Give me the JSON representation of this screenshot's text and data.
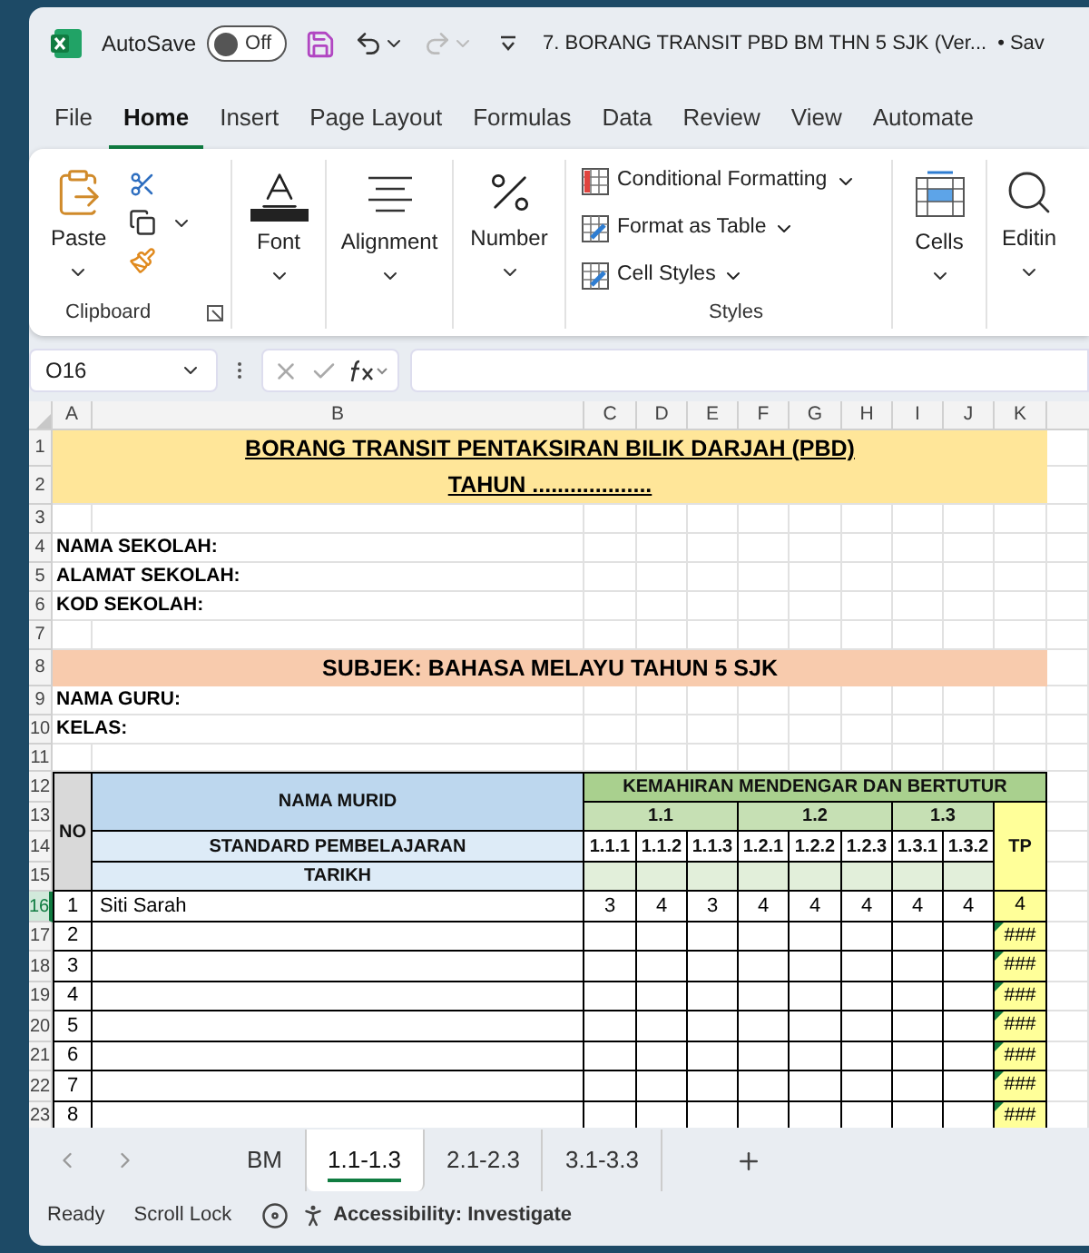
{
  "title_bar": {
    "autosave_label": "AutoSave",
    "autosave_toggle": {
      "label": "Off",
      "on": false
    },
    "redo_disabled": true,
    "document_title": "7. BORANG TRANSIT PBD BM THN 5 SJK (Ver...",
    "save_status": "• Sav"
  },
  "menu_tabs": [
    {
      "label": "File",
      "selected": false
    },
    {
      "label": "Home",
      "selected": true
    },
    {
      "label": "Insert",
      "selected": false
    },
    {
      "label": "Page Layout",
      "selected": false
    },
    {
      "label": "Formulas",
      "selected": false
    },
    {
      "label": "Data",
      "selected": false
    },
    {
      "label": "Review",
      "selected": false
    },
    {
      "label": "View",
      "selected": false
    },
    {
      "label": "Automate",
      "selected": false
    }
  ],
  "ribbon": {
    "paste": "Paste",
    "clipboard_group": "Clipboard",
    "font": "Font",
    "alignment": "Alignment",
    "number": "Number",
    "styles_items": [
      "Conditional Formatting",
      "Format as Table",
      "Cell Styles"
    ],
    "styles_group": "Styles",
    "cells": "Cells",
    "editing": "Editin"
  },
  "formula_bar": {
    "name_box": "O16"
  },
  "sheet": {
    "columns": [
      "A",
      "B",
      "C",
      "D",
      "E",
      "F",
      "G",
      "H",
      "I",
      "J",
      "K"
    ],
    "rows": [
      {
        "label": "1",
        "selected": false
      },
      {
        "label": "2",
        "selected": false
      },
      {
        "label": "3",
        "selected": false
      },
      {
        "label": "4",
        "selected": false
      },
      {
        "label": "5",
        "selected": false
      },
      {
        "label": "6",
        "selected": false
      },
      {
        "label": "7",
        "selected": false
      },
      {
        "label": "8",
        "selected": false
      },
      {
        "label": "9",
        "selected": false
      },
      {
        "label": "10",
        "selected": false
      },
      {
        "label": "11",
        "selected": false
      },
      {
        "label": "12",
        "selected": false
      },
      {
        "label": "13",
        "selected": false
      },
      {
        "label": "14",
        "selected": false
      },
      {
        "label": "15",
        "selected": false
      },
      {
        "label": "16",
        "selected": true
      },
      {
        "label": "17",
        "selected": false
      },
      {
        "label": "18",
        "selected": false
      },
      {
        "label": "19",
        "selected": false
      },
      {
        "label": "20",
        "selected": false
      },
      {
        "label": "21",
        "selected": false
      },
      {
        "label": "22",
        "selected": false
      },
      {
        "label": "23",
        "selected": false
      }
    ],
    "title": "BORANG TRANSIT PENTAKSIRAN BILIK DARJAH (PBD)",
    "year_line": "TAHUN ...................",
    "school_fields": [
      "NAMA SEKOLAH:",
      "ALAMAT SEKOLAH:",
      "KOD SEKOLAH:"
    ],
    "subject": "SUBJEK: BAHASA MELAYU TAHUN 5 SJK",
    "teacher_fields": [
      "NAMA GURU:",
      "KELAS:"
    ],
    "table": {
      "no_header": "NO",
      "name_header": "NAMA MURID",
      "standard_header": "STANDARD PEMBELAJARAN",
      "date_header": "TARIKH",
      "skill": "KEMAHIRAN MENDENGAR DAN BERTUTUR",
      "tp_header": "TP",
      "groups": [
        {
          "label": "1.1",
          "standards": [
            "1.1.1",
            "1.1.2",
            "1.1.3"
          ]
        },
        {
          "label": "1.2",
          "standards": [
            "1.2.1",
            "1.2.2",
            "1.2.3"
          ]
        },
        {
          "label": "1.3",
          "standards": [
            "1.3.1",
            "1.3.2"
          ]
        }
      ],
      "rows": [
        {
          "no": "1",
          "name": "Siti Sarah",
          "scores": [
            "3",
            "4",
            "3",
            "4",
            "4",
            "4",
            "4",
            "4"
          ],
          "tp": "4",
          "error_flag": false
        },
        {
          "no": "2",
          "tp": "###",
          "error_flag": true
        },
        {
          "no": "3",
          "tp": "###",
          "error_flag": true
        },
        {
          "no": "4",
          "tp": "###",
          "error_flag": true
        },
        {
          "no": "5",
          "tp": "###",
          "error_flag": true
        },
        {
          "no": "6",
          "tp": "###",
          "error_flag": true
        },
        {
          "no": "7",
          "tp": "###",
          "error_flag": true
        },
        {
          "no": "8",
          "tp": "###",
          "error_flag": true
        }
      ]
    }
  },
  "sheet_tabs": [
    {
      "label": "BM",
      "selected": false
    },
    {
      "label": "1.1-1.3",
      "selected": true
    },
    {
      "label": "2.1-2.3",
      "selected": false
    },
    {
      "label": "3.1-3.3",
      "selected": false
    }
  ],
  "status_bar": {
    "ready": "Ready",
    "scroll_lock": "Scroll Lock",
    "accessibility": "Accessibility: Investigate"
  }
}
